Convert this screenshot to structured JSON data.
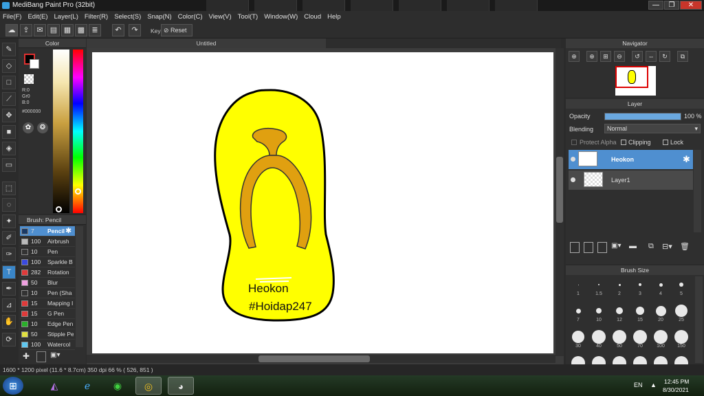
{
  "window": {
    "title": "MediBang Paint Pro (32bit)",
    "min_glyph": "—",
    "max_glyph": "❐",
    "close_glyph": "✕"
  },
  "menu": [
    "File(F)",
    "Edit(E)",
    "Layer(L)",
    "Filter(R)",
    "Select(S)",
    "Snap(N)",
    "Color(C)",
    "View(V)",
    "Tool(T)",
    "Window(W)",
    "Cloud",
    "Help"
  ],
  "toolbar": {
    "key_label": "Key",
    "reset_label": "Reset"
  },
  "color_panel": {
    "title": "Color",
    "r": "R:0",
    "g": "Gr0",
    "b": "B:0",
    "hex": "#000000"
  },
  "brush_panel": {
    "title": "Brush: Pencil",
    "items": [
      {
        "size": "7",
        "name": "Pencil",
        "color": "#1a3a66"
      },
      {
        "size": "100",
        "name": "Airbrush",
        "color": "#bbbbbb"
      },
      {
        "size": "10",
        "name": "Pen",
        "color": "#333333"
      },
      {
        "size": "100",
        "name": "Sparkle B",
        "color": "#3a4ae0"
      },
      {
        "size": "282",
        "name": "Rotation",
        "color": "#e03a3a"
      },
      {
        "size": "50",
        "name": "Blur",
        "color": "#f0a0e0"
      },
      {
        "size": "10",
        "name": "Pen (Sha",
        "color": "#333333"
      },
      {
        "size": "15",
        "name": "Mapping I",
        "color": "#e03a3a"
      },
      {
        "size": "15",
        "name": "G Pen",
        "color": "#e03a3a"
      },
      {
        "size": "10",
        "name": "Edge Pen",
        "color": "#2ab02a"
      },
      {
        "size": "50",
        "name": "Stipple Pe",
        "color": "#e0e040"
      },
      {
        "size": "100",
        "name": "Watercol",
        "color": "#60c8f0"
      }
    ]
  },
  "document": {
    "tab_title": "Untitled"
  },
  "artwork": {
    "text1": "Heokon",
    "text2": "#Hoidap247",
    "sandal_color": "#ffff00",
    "strap_color": "#e0a010"
  },
  "navigator": {
    "title": "Navigator"
  },
  "layer_panel": {
    "title": "Layer",
    "opacity_label": "Opacity",
    "opacity_value": "100 %",
    "opacity": 1.0,
    "blending_label": "Blending",
    "blending_value": "Normal",
    "protect_alpha": "Protect Alpha",
    "clipping": "Clipping",
    "lock": "Lock",
    "layers": [
      {
        "name": "Heokon"
      },
      {
        "name": "Layer1"
      }
    ]
  },
  "brush_size": {
    "title": "Brush Size",
    "row1": [
      "1",
      "1.5",
      "2",
      "3",
      "4",
      "5"
    ],
    "row2": [
      "7",
      "10",
      "12",
      "15",
      "20",
      "25"
    ],
    "row3": [
      "30",
      "40",
      "50",
      "70",
      "100",
      "150"
    ]
  },
  "status": "1600 * 1200 pixel   (11.6 * 8.7cm)   350 dpi   66 %   ( 526, 851 )",
  "taskbar": {
    "lang": "EN",
    "time": "12:45 PM",
    "date": "8/30/2021"
  }
}
